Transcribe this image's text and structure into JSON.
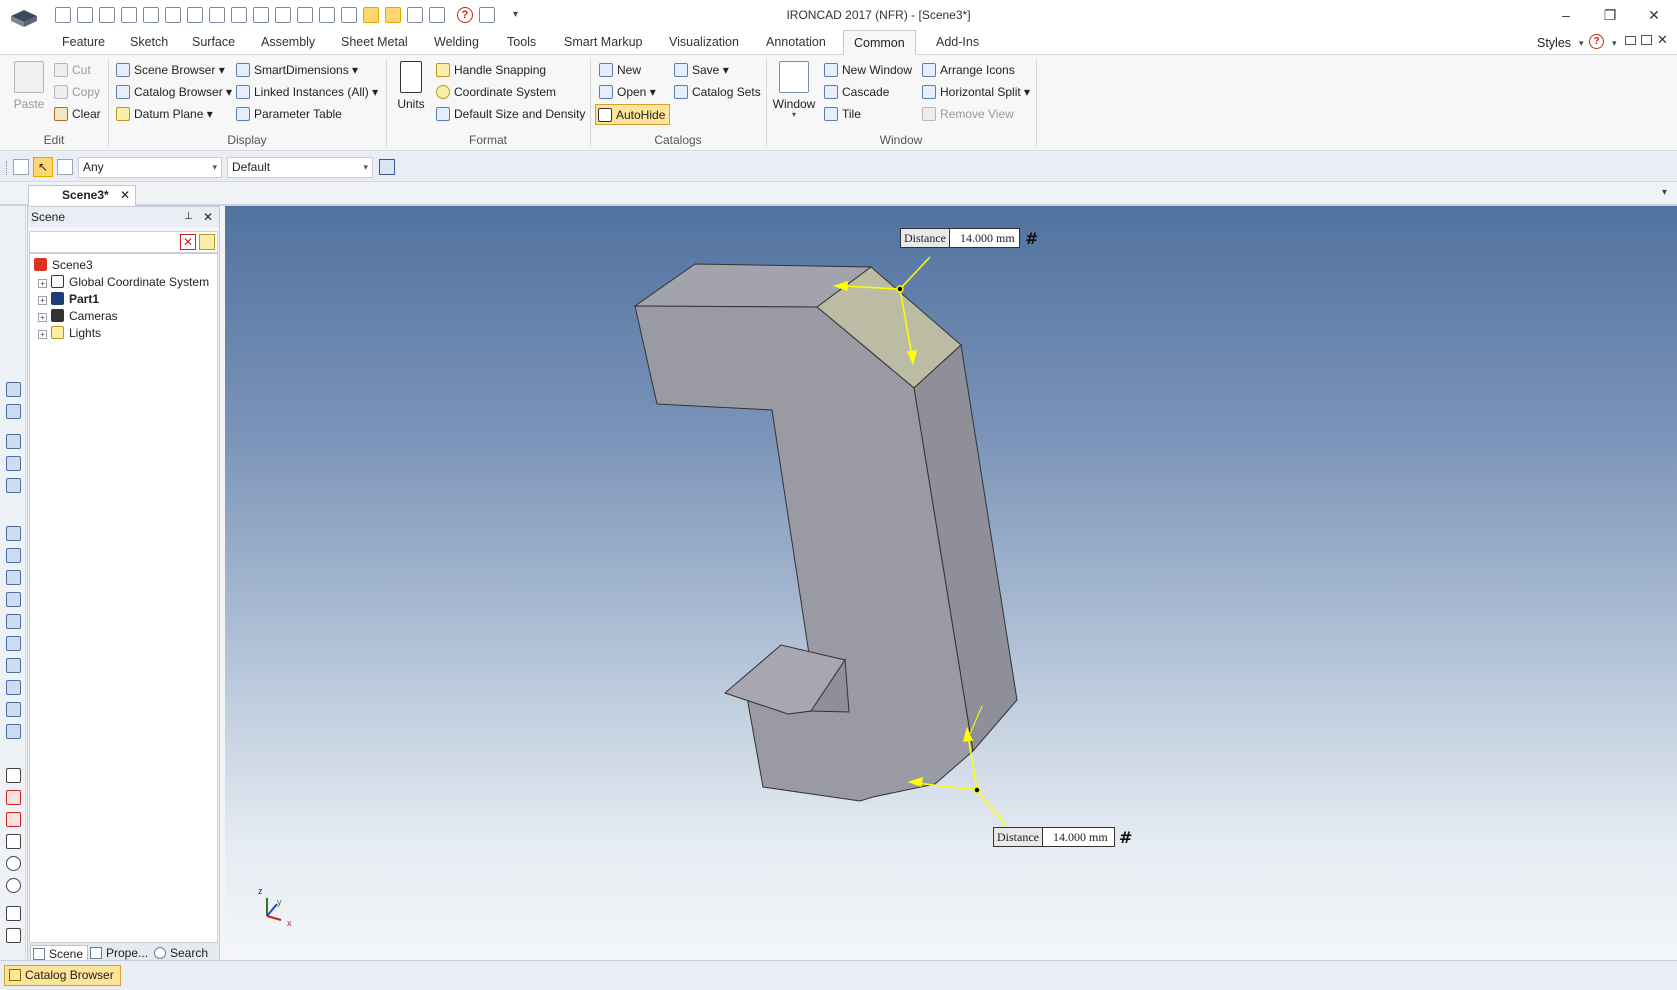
{
  "window": {
    "title": "IRONCAD 2017 (NFR) - [Scene3*]",
    "minimize": "–",
    "restore": "❐",
    "close": "✕"
  },
  "ribbon_tabs": [
    "Feature",
    "Sketch",
    "Surface",
    "Assembly",
    "Sheet Metal",
    "Welding",
    "Tools",
    "Smart Markup",
    "Visualization",
    "Annotation",
    "Common",
    "Add-Ins"
  ],
  "active_tab": "Common",
  "styles_label": "Styles",
  "groups": {
    "edit": {
      "label": "Edit",
      "paste": "Paste",
      "cut": "Cut",
      "copy": "Copy",
      "clear": "Clear"
    },
    "display": {
      "label": "Display",
      "scene_browser": "Scene Browser",
      "catalog_browser": "Catalog Browser",
      "datum_plane": "Datum Plane",
      "smart_dimensions": "SmartDimensions",
      "linked_instances": "Linked Instances (All)",
      "parameter_table": "Parameter Table"
    },
    "format": {
      "label": "Format",
      "units": "Units",
      "handle_snapping": "Handle Snapping",
      "coordinate_system": "Coordinate System",
      "default_size": "Default Size and Density"
    },
    "catalogs": {
      "label": "Catalogs",
      "new": "New",
      "open": "Open",
      "autohide": "AutoHide",
      "save": "Save",
      "catalog_sets": "Catalog Sets"
    },
    "window": {
      "label": "Window",
      "window": "Window",
      "new_window": "New Window",
      "cascade": "Cascade",
      "tile": "Tile",
      "arrange_icons": "Arrange Icons",
      "horizontal_split": "Horizontal Split",
      "remove_view": "Remove View"
    }
  },
  "selection_toolbar": {
    "filter_value": "Any",
    "style_value": "Default"
  },
  "document_tab": "Scene3*",
  "scene_panel": {
    "title": "Scene",
    "tree": [
      {
        "label": "Scene3",
        "bold": false
      },
      {
        "label": "Global Coordinate System",
        "bold": false
      },
      {
        "label": "Part1",
        "bold": true
      },
      {
        "label": "Cameras",
        "bold": false
      },
      {
        "label": "Lights",
        "bold": false
      }
    ],
    "bottom_tabs": [
      "Scene",
      "Prope...",
      "Search"
    ]
  },
  "viewport": {
    "dimension_top": {
      "label": "Distance",
      "value": "14.000 mm"
    },
    "dimension_bottom": {
      "label": "Distance",
      "value": "14.000 mm"
    },
    "axis_labels": {
      "z": "z",
      "y": "y",
      "x": "x"
    }
  },
  "status": {
    "catalog_browser": "Catalog Browser"
  },
  "colors": {
    "part_face": "#9a9aa4",
    "part_top": "#a0a0aa",
    "chamfer_face": "#bcbca4",
    "dimension_line": "#ffff00",
    "autohide_bg": "#fde49a"
  }
}
